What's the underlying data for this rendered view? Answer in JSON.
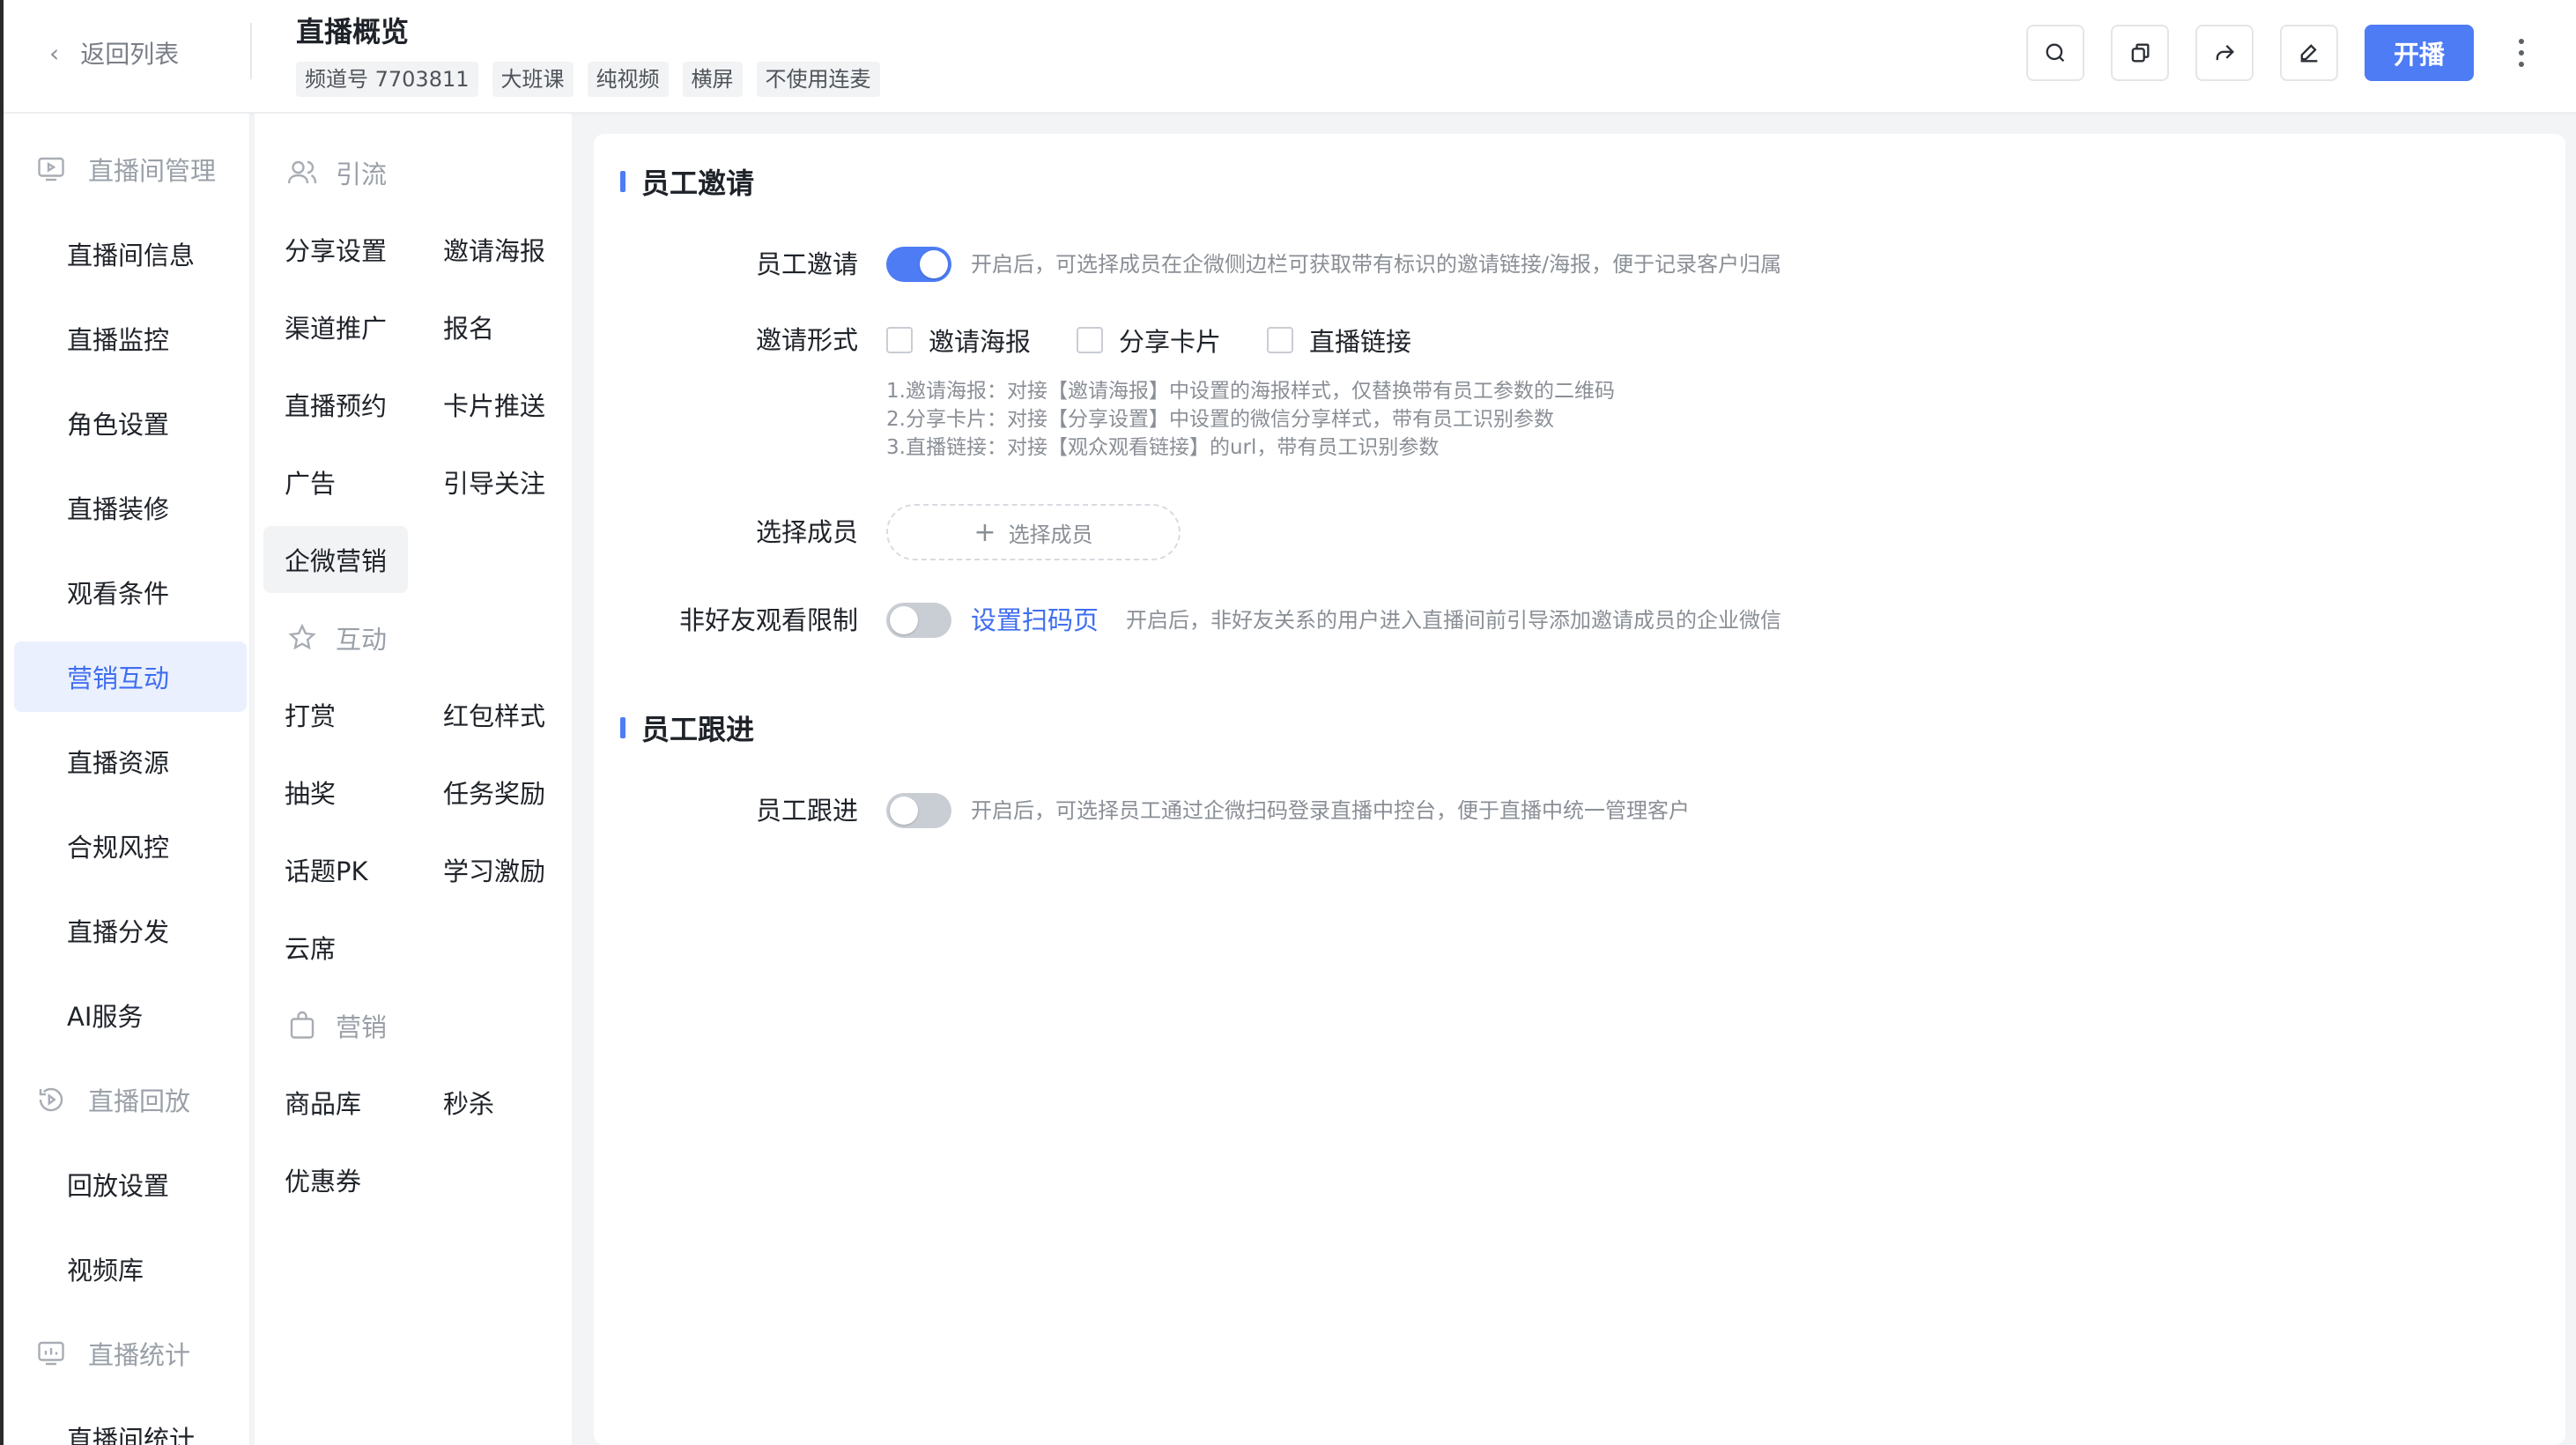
{
  "header": {
    "back_label": "返回列表",
    "title": "直播概览",
    "tags": [
      "频道号 7703811",
      "大班课",
      "纯视频",
      "横屏",
      "不使用连麦"
    ],
    "start_label": "开播",
    "icons": [
      "search-icon",
      "copy-icon",
      "share-icon",
      "edit-icon",
      "more-icon"
    ]
  },
  "nav": {
    "groups": {
      "room": "直播间管理",
      "playback": "直播回放",
      "stats": "直播统计"
    },
    "items": [
      "直播间信息",
      "直播监控",
      "角色设置",
      "直播装修",
      "观看条件",
      "营销互动",
      "直播资源",
      "合规风控",
      "直播分发",
      "AI服务"
    ],
    "playback_items": [
      "回放设置",
      "视频库"
    ],
    "stats_items": [
      "直播间统计"
    ],
    "active": "营销互动"
  },
  "subnav": {
    "groups": {
      "traffic": "引流",
      "interact": "互动",
      "marketing": "营销"
    },
    "traffic_items": [
      "分享设置",
      "邀请海报",
      "渠道推广",
      "报名",
      "直播预约",
      "卡片推送",
      "广告",
      "引导关注",
      "企微营销"
    ],
    "interact_items": [
      "打赏",
      "红包样式",
      "抽奖",
      "任务奖励",
      "话题PK",
      "学习激励",
      "云席"
    ],
    "marketing_items": [
      "商品库",
      "秒杀",
      "优惠券"
    ],
    "active": "企微营销"
  },
  "main": {
    "section1_title": "员工邀请",
    "invite_label": "员工邀请",
    "invite_enabled": true,
    "invite_hint": "开启后，可选择成员在企微侧边栏可获取带有标识的邀请链接/海报，便于记录客户归属",
    "form_label": "邀请形式",
    "form_options": [
      "邀请海报",
      "分享卡片",
      "直播链接"
    ],
    "notes": [
      "1.邀请海报：对接【邀请海报】中设置的海报样式，仅替换带有员工参数的二维码",
      "2.分享卡片：对接【分享设置】中设置的微信分享样式，带有员工识别参数",
      "3.直播链接：对接【观众观看链接】的url，带有员工识别参数"
    ],
    "members_label": "选择成员",
    "members_button": "选择成员",
    "nonfriend_label": "非好友观看限制",
    "nonfriend_enabled": false,
    "nonfriend_link": "设置扫码页",
    "nonfriend_hint": "开启后，非好友关系的用户进入直播间前引导添加邀请成员的企业微信",
    "section2_title": "员工跟进",
    "followup_label": "员工跟进",
    "followup_enabled": false,
    "followup_hint": "开启后，可选择员工通过企微扫码登录直播中控台，便于直播中统一管理客户"
  },
  "colors": {
    "accent": "#4d7cf4",
    "active_bg": "#ebf0fe"
  }
}
